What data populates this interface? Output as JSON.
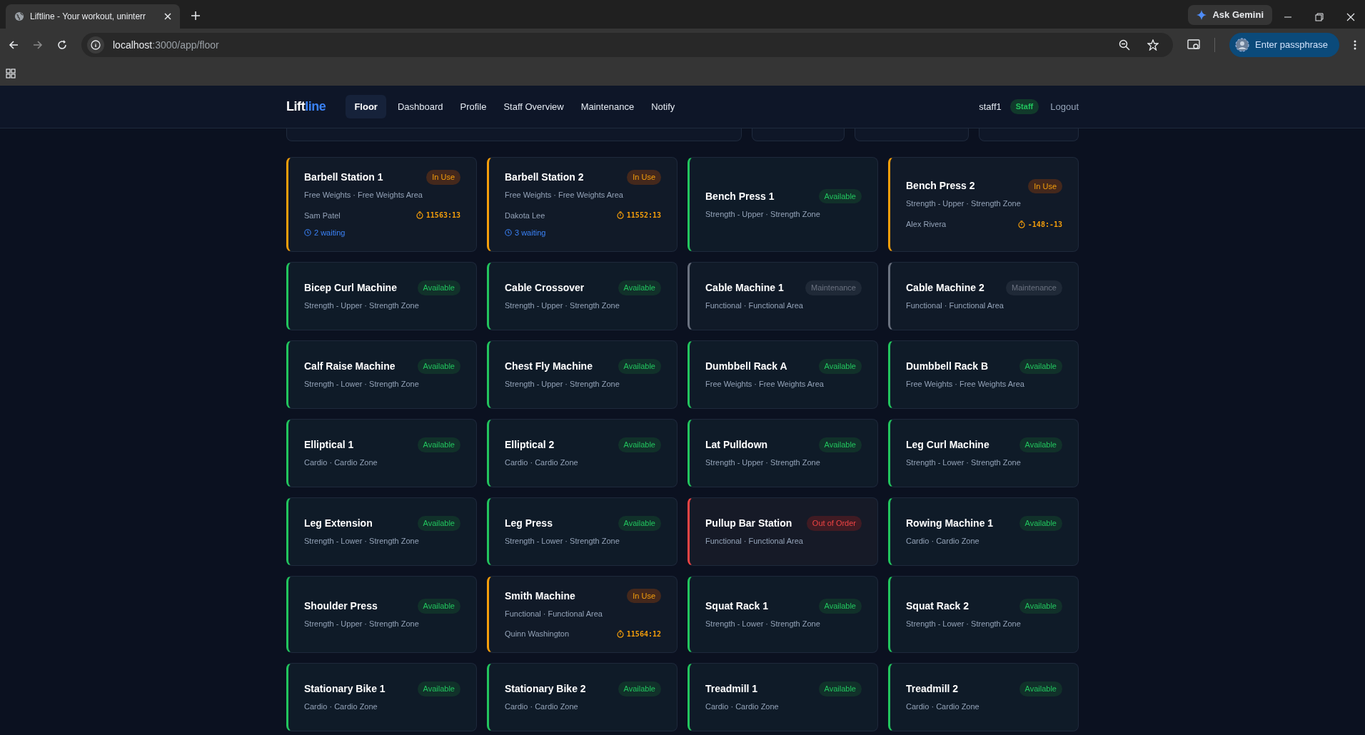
{
  "browser": {
    "tab_title": "Liftline - Your workout, uninterr",
    "url_host": "localhost",
    "url_path": ":3000/app/floor",
    "gemini": "Ask Gemini",
    "profile": "Enter passphrase"
  },
  "nav": {
    "logo_a": "Lift",
    "logo_b": "line",
    "links": [
      {
        "label": "Floor",
        "selected": true
      },
      {
        "label": "Dashboard",
        "selected": false
      },
      {
        "label": "Profile",
        "selected": false
      },
      {
        "label": "Staff Overview",
        "selected": false
      },
      {
        "label": "Maintenance",
        "selected": false
      },
      {
        "label": "Notify",
        "selected": false
      }
    ],
    "user": "staff1",
    "role": "Staff",
    "logout": "Logout"
  },
  "cards": [
    {
      "name": "Barbell Station 1",
      "status": "In Use",
      "kind": "in_use",
      "meta": "Free Weights · Free Weights Area",
      "user": "Sam Patel",
      "timer": "11563:13",
      "waiting": "2 waiting"
    },
    {
      "name": "Barbell Station 2",
      "status": "In Use",
      "kind": "in_use",
      "meta": "Free Weights · Free Weights Area",
      "user": "Dakota Lee",
      "timer": "11552:13",
      "waiting": "3 waiting"
    },
    {
      "name": "Bench Press 1",
      "status": "Available",
      "kind": "available",
      "meta": "Strength - Upper · Strength Zone"
    },
    {
      "name": "Bench Press 2",
      "status": "In Use",
      "kind": "in_use",
      "meta": "Strength - Upper · Strength Zone",
      "user": "Alex Rivera",
      "timer": "-148:-13"
    },
    {
      "name": "Bicep Curl Machine",
      "status": "Available",
      "kind": "available",
      "meta": "Strength - Upper · Strength Zone"
    },
    {
      "name": "Cable Crossover",
      "status": "Available",
      "kind": "available",
      "meta": "Strength - Upper · Strength Zone"
    },
    {
      "name": "Cable Machine 1",
      "status": "Maintenance",
      "kind": "maintenance",
      "meta": "Functional · Functional Area"
    },
    {
      "name": "Cable Machine 2",
      "status": "Maintenance",
      "kind": "maintenance",
      "meta": "Functional · Functional Area"
    },
    {
      "name": "Calf Raise Machine",
      "status": "Available",
      "kind": "available",
      "meta": "Strength - Lower · Strength Zone"
    },
    {
      "name": "Chest Fly Machine",
      "status": "Available",
      "kind": "available",
      "meta": "Strength - Upper · Strength Zone"
    },
    {
      "name": "Dumbbell Rack A",
      "status": "Available",
      "kind": "available",
      "meta": "Free Weights · Free Weights Area"
    },
    {
      "name": "Dumbbell Rack B",
      "status": "Available",
      "kind": "available",
      "meta": "Free Weights · Free Weights Area"
    },
    {
      "name": "Elliptical 1",
      "status": "Available",
      "kind": "available",
      "meta": "Cardio · Cardio Zone"
    },
    {
      "name": "Elliptical 2",
      "status": "Available",
      "kind": "available",
      "meta": "Cardio · Cardio Zone"
    },
    {
      "name": "Lat Pulldown",
      "status": "Available",
      "kind": "available",
      "meta": "Strength - Upper · Strength Zone"
    },
    {
      "name": "Leg Curl Machine",
      "status": "Available",
      "kind": "available",
      "meta": "Strength - Lower · Strength Zone"
    },
    {
      "name": "Leg Extension",
      "status": "Available",
      "kind": "available",
      "meta": "Strength - Lower · Strength Zone"
    },
    {
      "name": "Leg Press",
      "status": "Available",
      "kind": "available",
      "meta": "Strength - Lower · Strength Zone"
    },
    {
      "name": "Pullup Bar Station",
      "status": "Out of Order",
      "kind": "out_of_order",
      "meta": "Functional · Functional Area"
    },
    {
      "name": "Rowing Machine 1",
      "status": "Available",
      "kind": "available",
      "meta": "Cardio · Cardio Zone"
    },
    {
      "name": "Shoulder Press",
      "status": "Available",
      "kind": "available",
      "meta": "Strength - Upper · Strength Zone"
    },
    {
      "name": "Smith Machine",
      "status": "In Use",
      "kind": "in_use",
      "meta": "Functional · Functional Area",
      "user": "Quinn Washington",
      "timer": "11564:12"
    },
    {
      "name": "Squat Rack 1",
      "status": "Available",
      "kind": "available",
      "meta": "Strength - Lower · Strength Zone"
    },
    {
      "name": "Squat Rack 2",
      "status": "Available",
      "kind": "available",
      "meta": "Strength - Lower · Strength Zone"
    },
    {
      "name": "Stationary Bike 1",
      "status": "Available",
      "kind": "available",
      "meta": "Cardio · Cardio Zone"
    },
    {
      "name": "Stationary Bike 2",
      "status": "Available",
      "kind": "available",
      "meta": "Cardio · Cardio Zone"
    },
    {
      "name": "Treadmill 1",
      "status": "Available",
      "kind": "available",
      "meta": "Cardio · Cardio Zone"
    },
    {
      "name": "Treadmill 2",
      "status": "Available",
      "kind": "available",
      "meta": "Cardio · Cardio Zone"
    }
  ]
}
